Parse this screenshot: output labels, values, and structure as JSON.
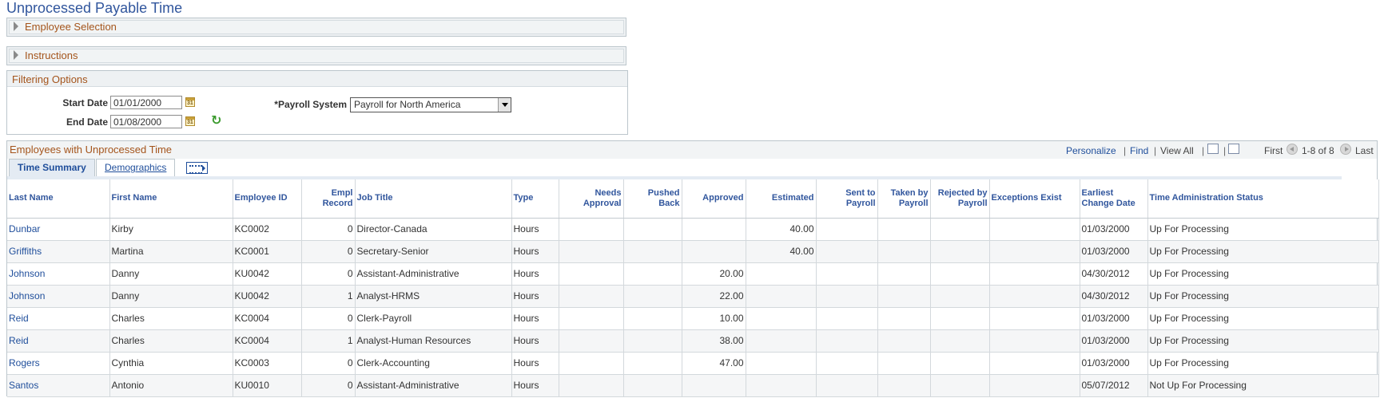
{
  "page_title": "Unprocessed Payable Time",
  "sections": {
    "employee_selection": "Employee Selection",
    "instructions": "Instructions",
    "filtering_options": "Filtering Options"
  },
  "filters": {
    "start_date_label": "Start Date",
    "start_date_value": "01/01/2000",
    "end_date_label": "End Date",
    "end_date_value": "01/08/2000",
    "payroll_system_label": "*Payroll System",
    "payroll_system_value": "Payroll for North America",
    "calendar_icon_text": "31"
  },
  "grid": {
    "title": "Employees with Unprocessed Time",
    "nav": {
      "personalize": "Personalize",
      "find": "Find",
      "view_all": "View All",
      "sep": "|",
      "first": "First",
      "range": "1-8 of 8",
      "last": "Last"
    },
    "tabs": [
      {
        "label": "Time Summary",
        "active": true
      },
      {
        "label": "Demographics",
        "active": false
      }
    ],
    "columns": [
      "Last Name",
      "First Name",
      "Employee ID",
      "Empl Record",
      "Job Title",
      "Type",
      "Needs Approval",
      "Pushed Back",
      "Approved",
      "Estimated",
      "Sent to Payroll",
      "Taken by Payroll",
      "Rejected by Payroll",
      "Exceptions Exist",
      "Earliest Change Date",
      "Time Administration Status"
    ],
    "rows": [
      [
        "Dunbar",
        "Kirby",
        "KC0002",
        "0",
        "Director-Canada",
        "Hours",
        "",
        "",
        "",
        "40.00",
        "",
        "",
        "",
        "",
        "01/03/2000",
        "Up For Processing"
      ],
      [
        "Griffiths",
        "Martina",
        "KC0001",
        "0",
        "Secretary-Senior",
        "Hours",
        "",
        "",
        "",
        "40.00",
        "",
        "",
        "",
        "",
        "01/03/2000",
        "Up For Processing"
      ],
      [
        "Johnson",
        "Danny",
        "KU0042",
        "0",
        "Assistant-Administrative",
        "Hours",
        "",
        "",
        "20.00",
        "",
        "",
        "",
        "",
        "",
        "04/30/2012",
        "Up For Processing"
      ],
      [
        "Johnson",
        "Danny",
        "KU0042",
        "1",
        "Analyst-HRMS",
        "Hours",
        "",
        "",
        "22.00",
        "",
        "",
        "",
        "",
        "",
        "04/30/2012",
        "Up For Processing"
      ],
      [
        "Reid",
        "Charles",
        "KC0004",
        "0",
        "Clerk-Payroll",
        "Hours",
        "",
        "",
        "10.00",
        "",
        "",
        "",
        "",
        "",
        "01/03/2000",
        "Up For Processing"
      ],
      [
        "Reid",
        "Charles",
        "KC0004",
        "1",
        "Analyst-Human Resources",
        "Hours",
        "",
        "",
        "38.00",
        "",
        "",
        "",
        "",
        "",
        "01/03/2000",
        "Up For Processing"
      ],
      [
        "Rogers",
        "Cynthia",
        "KC0003",
        "0",
        "Clerk-Accounting",
        "Hours",
        "",
        "",
        "47.00",
        "",
        "",
        "",
        "",
        "",
        "01/03/2000",
        "Up For Processing"
      ],
      [
        "Santos",
        "Antonio",
        "KU0010",
        "0",
        "Assistant-Administrative",
        "Hours",
        "",
        "",
        "",
        "",
        "",
        "",
        "",
        "",
        "05/07/2012",
        "Not Up For Processing"
      ]
    ]
  },
  "colors": {
    "title_blue": "#31569d",
    "link_blue": "#1f4e9b",
    "section_orange": "#a4541b"
  }
}
